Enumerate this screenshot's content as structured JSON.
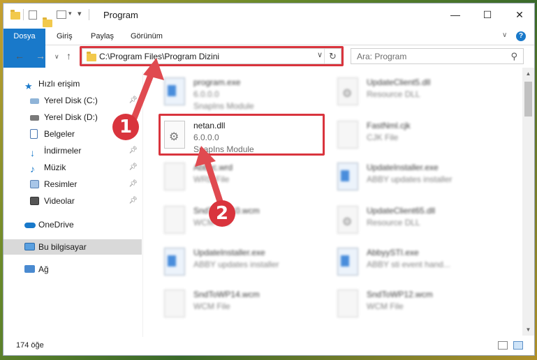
{
  "window": {
    "title": "Program"
  },
  "ribbon": {
    "tabs": [
      "Dosya",
      "Giriş",
      "Paylaş",
      "Görünüm"
    ]
  },
  "address": {
    "path": "C:\\Program Files\\Program Dizini"
  },
  "search": {
    "placeholder": "Ara: Program"
  },
  "sidebar": {
    "items": [
      {
        "label": "Hızlı erişim",
        "icon": "star-icon"
      },
      {
        "label": "Yerel Disk (C:)",
        "icon": "disk-icon"
      },
      {
        "label": "Yerel Disk (D:)",
        "icon": "disk-icon"
      },
      {
        "label": "Belgeler",
        "icon": "documents-icon"
      },
      {
        "label": "İndirmeler",
        "icon": "downloads-icon"
      },
      {
        "label": "Müzik",
        "icon": "music-icon"
      },
      {
        "label": "Resimler",
        "icon": "pictures-icon"
      },
      {
        "label": "Videolar",
        "icon": "videos-icon"
      },
      {
        "label": "OneDrive",
        "icon": "cloud-icon"
      },
      {
        "label": "Bu bilgisayar",
        "icon": "computer-icon"
      },
      {
        "label": "Ağ",
        "icon": "network-icon"
      }
    ]
  },
  "files": {
    "left": [
      {
        "name": "program.exe",
        "l2": "6.0.0.0",
        "l3": "SnapIns Module"
      },
      {
        "name": "netan.dll",
        "l2": "6.0.0.0",
        "l3": "SnapIns Module"
      },
      {
        "name": "Abbyc.wrd",
        "l2": "WRD File",
        "l3": ""
      },
      {
        "name": "SndToWP10.wcm",
        "l2": "WCM File",
        "l3": ""
      },
      {
        "name": "UpdateInstaller.exe",
        "l2": "ABBY updates installer",
        "l3": ""
      },
      {
        "name": "SndToWP14.wcm",
        "l2": "WCM File",
        "l3": ""
      }
    ],
    "right": [
      {
        "name": "UpdateClient5.dll",
        "l2": "Resource DLL",
        "l3": ""
      },
      {
        "name": "FastNml.cjk",
        "l2": "CJK File",
        "l3": ""
      },
      {
        "name": "UpdateInstaller.exe",
        "l2": "ABBY updates installer",
        "l3": ""
      },
      {
        "name": "UpdateClient65.dll",
        "l2": "Resource DLL",
        "l3": ""
      },
      {
        "name": "AbbyySTI.exe",
        "l2": "ABBY sti event hand...",
        "l3": ""
      },
      {
        "name": "SndToWP12.wcm",
        "l2": "WCM File",
        "l3": ""
      }
    ]
  },
  "status": {
    "count": "174 öğe"
  },
  "callouts": {
    "one": "1",
    "two": "2"
  },
  "colors": {
    "accent": "#1979ca",
    "highlight": "#d9343d"
  }
}
